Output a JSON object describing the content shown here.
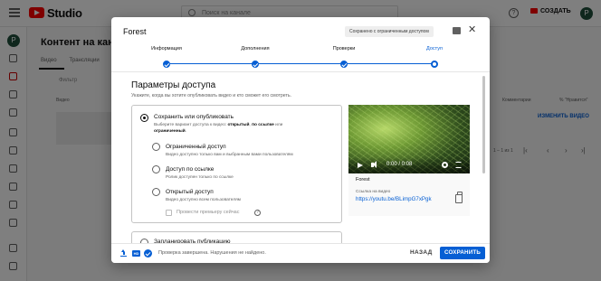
{
  "header": {
    "logo_text": "Studio",
    "search_placeholder": "Поиск на канале",
    "help_icon": "help-icon",
    "create_label": "СОЗДАТЬ",
    "avatar_letter": "P"
  },
  "background": {
    "page_title": "Контент на канале",
    "tabs": [
      "Видео",
      "Трансляции"
    ],
    "filter_label": "Фильтр",
    "columns": [
      "Видео",
      "Комментарии",
      "% \"Нравится\""
    ],
    "rename_label": "ИЗМЕНИТЬ ВИДЕО",
    "pagination": "1 – 1 из 1"
  },
  "dialog": {
    "title": "Forest",
    "saved_badge": "Сохранено с ограниченным доступом",
    "steps": [
      "Информация",
      "Дополнения",
      "Проверки",
      "Доступ"
    ],
    "current_step": "Доступ",
    "section_title": "Параметры доступа",
    "section_desc": "Укажите, когда вы хотите опубликовать видео и кто сможет его смотреть.",
    "visibility": {
      "main_label": "Сохранить или опубликовать",
      "main_desc_prefix": "Выберите вариант доступа к видео: ",
      "main_desc_bold1": "открытый",
      "main_desc_sep": ", ",
      "main_desc_bold2": "по ссылке",
      "main_desc_or": " или",
      "main_desc_bold3": "ограниченный",
      "main_desc_end": ".",
      "options": [
        {
          "label": "Ограниченный доступ",
          "desc": "Видео доступно только вам и выбранным вами пользователям"
        },
        {
          "label": "Доступ по ссылке",
          "desc": "Ролик доступен только по ссылке"
        },
        {
          "label": "Открытый доступ",
          "desc": "Видео доступно всем пользователям"
        }
      ],
      "premiere_label": "Провести премьеру сейчас",
      "schedule_label": "Запланировать публикацию"
    },
    "preview": {
      "time": "0:00 / 0:08",
      "video_name": "Forest",
      "link_label": "Ссылка на видео",
      "link": "https://youtu.be/BLimpG7xPgk"
    },
    "footer": {
      "hd_label": "HD",
      "status": "Проверка завершена. Нарушения не найдено.",
      "back_label": "НАЗАД",
      "save_label": "СОХРАНИТЬ"
    }
  },
  "colors": {
    "accent": "#065fd4",
    "brand": "#ff0000"
  }
}
